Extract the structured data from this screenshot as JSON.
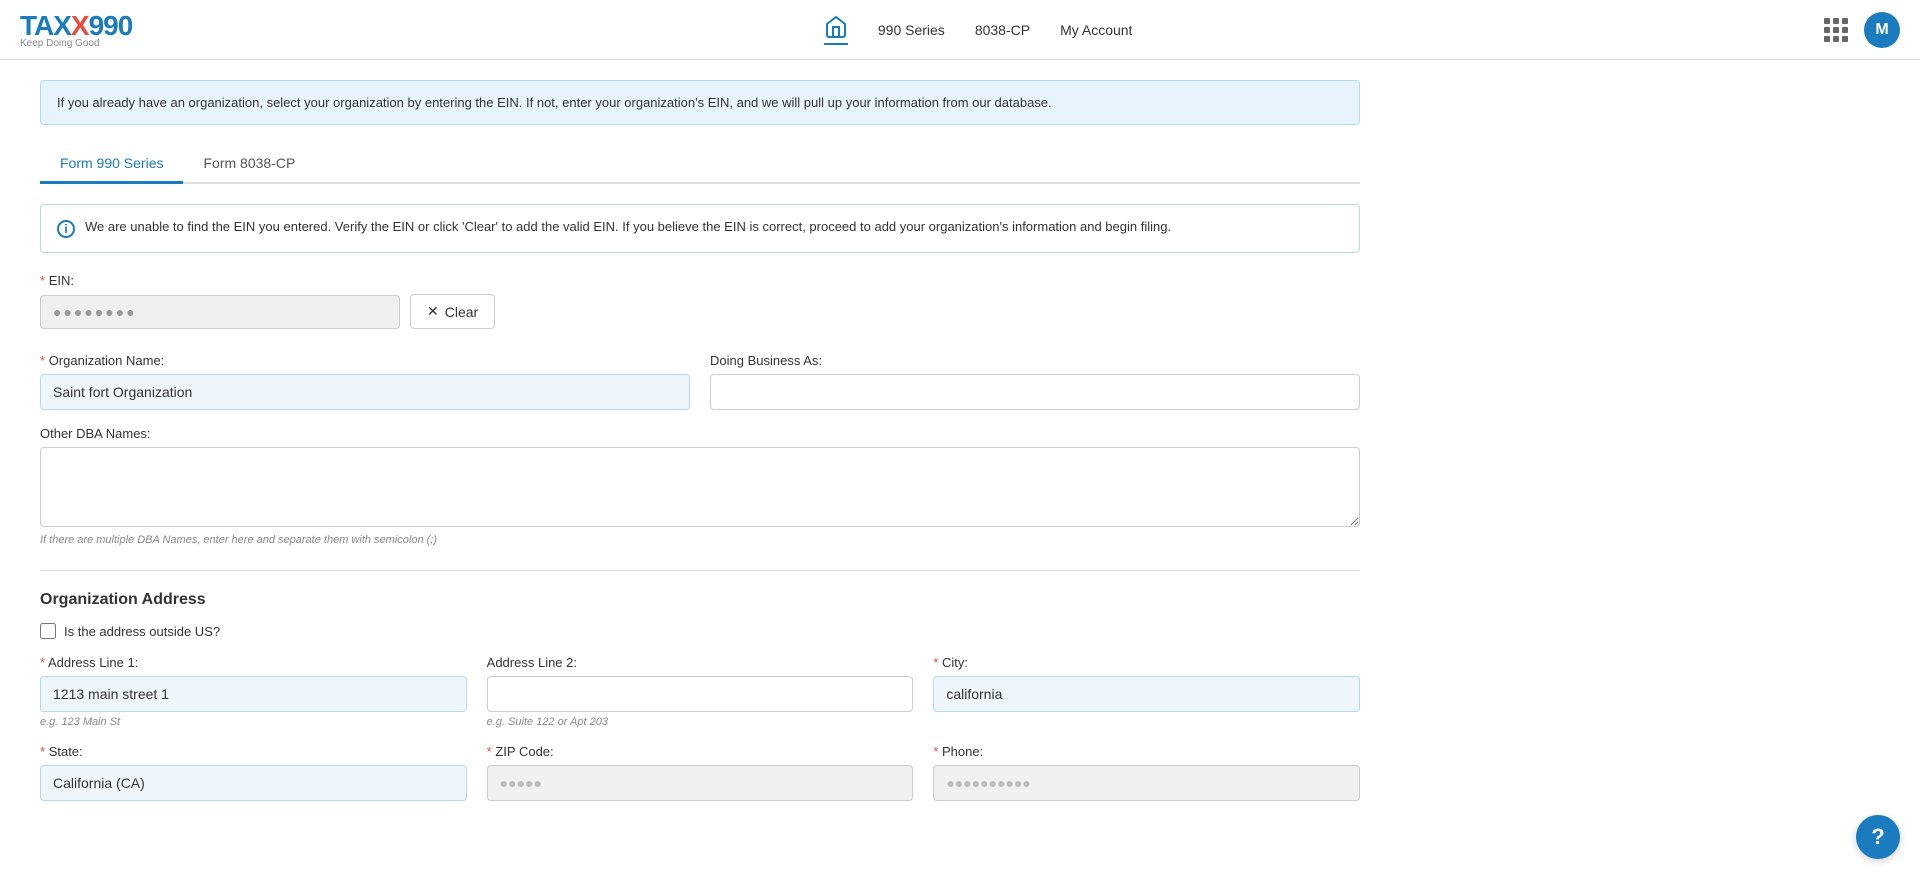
{
  "header": {
    "logo_main": "TAX990",
    "logo_x": "X",
    "logo_sub": "Keep Doing Good",
    "nav_990_series": "990 Series",
    "nav_8038cp": "8038-CP",
    "nav_my_account": "My Account",
    "avatar_letter": "M"
  },
  "info_bar": {
    "text": "If you already have an organization, select your organization by entering the EIN. If not, enter your organization's EIN, and we will pull up your information from our database."
  },
  "tabs": [
    {
      "label": "Form 990 Series",
      "active": true
    },
    {
      "label": "Form 8038-CP",
      "active": false
    }
  ],
  "alert": {
    "text": "We are unable to find the EIN you entered. Verify the EIN or click 'Clear' to add the valid EIN. If you believe the EIN is correct, proceed to add your organization's information and begin filing."
  },
  "form": {
    "ein_label": "EIN:",
    "ein_required": "*",
    "ein_value": "●●●●●●●●",
    "clear_button": "Clear",
    "org_name_label": "Organization Name:",
    "org_name_required": "*",
    "org_name_value": "Saint fort Organization",
    "dba_label": "Doing Business As:",
    "dba_value": "",
    "other_dba_label": "Other DBA Names:",
    "other_dba_value": "",
    "other_dba_hint": "If there are multiple DBA Names, enter here and separate them with semicolon (;)",
    "address_section_title": "Organization Address",
    "outside_us_label": "Is the address outside US?",
    "address1_label": "Address Line 1:",
    "address1_required": "*",
    "address1_value": "1213 main street 1",
    "address1_placeholder": "e.g. 123 Main St",
    "address2_label": "Address Line 2:",
    "address2_value": "",
    "address2_placeholder": "e.g. Suite 122 or Apt 203",
    "city_label": "City:",
    "city_required": "*",
    "city_value": "california",
    "state_label": "State:",
    "state_required": "*",
    "state_value": "California (CA)",
    "zip_label": "ZIP Code:",
    "zip_required": "*",
    "zip_value": "●●●●●",
    "phone_label": "Phone:",
    "phone_required": "*",
    "phone_value": "●●●●●●●●●●"
  },
  "help": {
    "label": "?"
  }
}
